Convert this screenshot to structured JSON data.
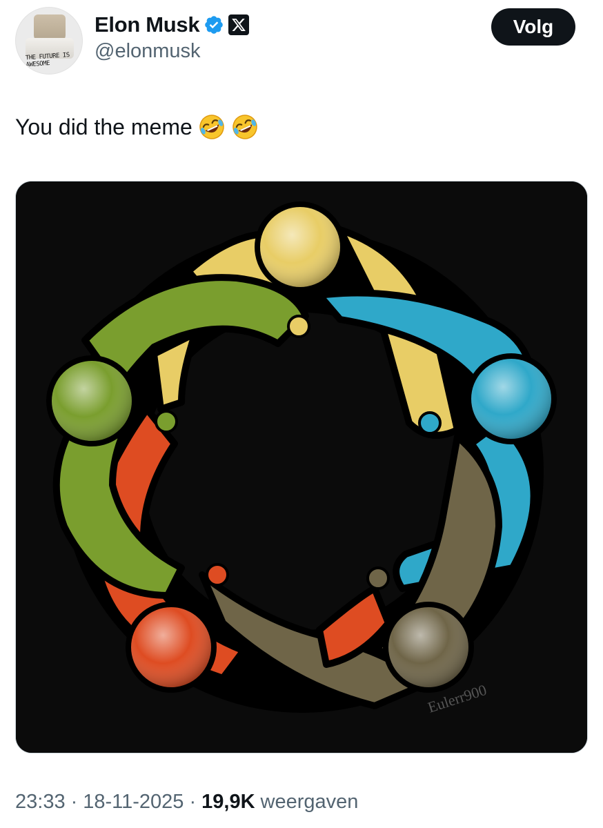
{
  "author": {
    "display_name": "Elon Musk",
    "handle": "@elonmusk",
    "verified": true,
    "affiliate": "X",
    "avatar_caption": "THE FUTURE IS AWESOME"
  },
  "follow_label": "Volg",
  "tweet": {
    "text": "You did the meme",
    "emojis": [
      "rolling-on-floor-laughing",
      "rolling-on-floor-laughing"
    ]
  },
  "media": {
    "watermark": "Eulerr900",
    "colors": {
      "yellow": "#e8cd66",
      "blue": "#2fa8c9",
      "brown": "#6f6548",
      "orange": "#de4c22",
      "green": "#7a9e2e",
      "background": "#0b0b0b"
    }
  },
  "meta": {
    "time": "23:33",
    "separator": "·",
    "date": "18-11-2025",
    "views_count": "19,9K",
    "views_label": "weergaven"
  },
  "theme": {
    "text_primary": "#0f1419",
    "text_secondary": "#536471",
    "verified_blue": "#1d9bf0"
  }
}
